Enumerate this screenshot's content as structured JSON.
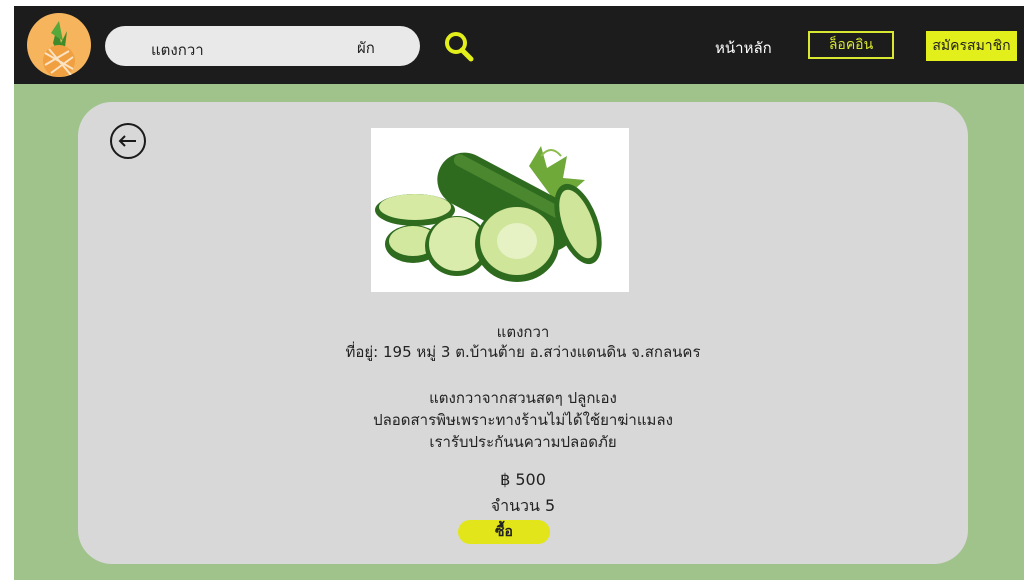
{
  "header": {
    "search": {
      "value": "แตงกวา",
      "category": "ผัก"
    },
    "nav_home": "หน้าหลัก",
    "login_label": "ล็อคอิน",
    "register_label": "สมัครสมาชิก"
  },
  "product": {
    "name": "แตงกวา",
    "address": "ที่อยู่: 195 หมู่ 3 ต.บ้านต้าย อ.สว่างแดนดิน จ.สกลนคร",
    "description": [
      "แตงกวาจากสวนสดๆ ปลูกเอง",
      "ปลอดสารพิษเพราะทางร้านไม่ได้ใช้ยาฆ่าแมลง",
      "เรารับประกันนความปลอดภัย"
    ],
    "price": "฿ 500",
    "quantity": "จำนวน 5",
    "buy_label": "ซื้อ"
  },
  "icons": {
    "logo": "pineapple-logo",
    "search": "search-icon",
    "back": "back-arrow-icon",
    "photo": "cucumber-photo"
  },
  "colors": {
    "header_bg": "#1c1c1c",
    "page_bg": "#a0c38b",
    "card_bg": "#d8d8d8",
    "accent": "#e3ef1a"
  }
}
